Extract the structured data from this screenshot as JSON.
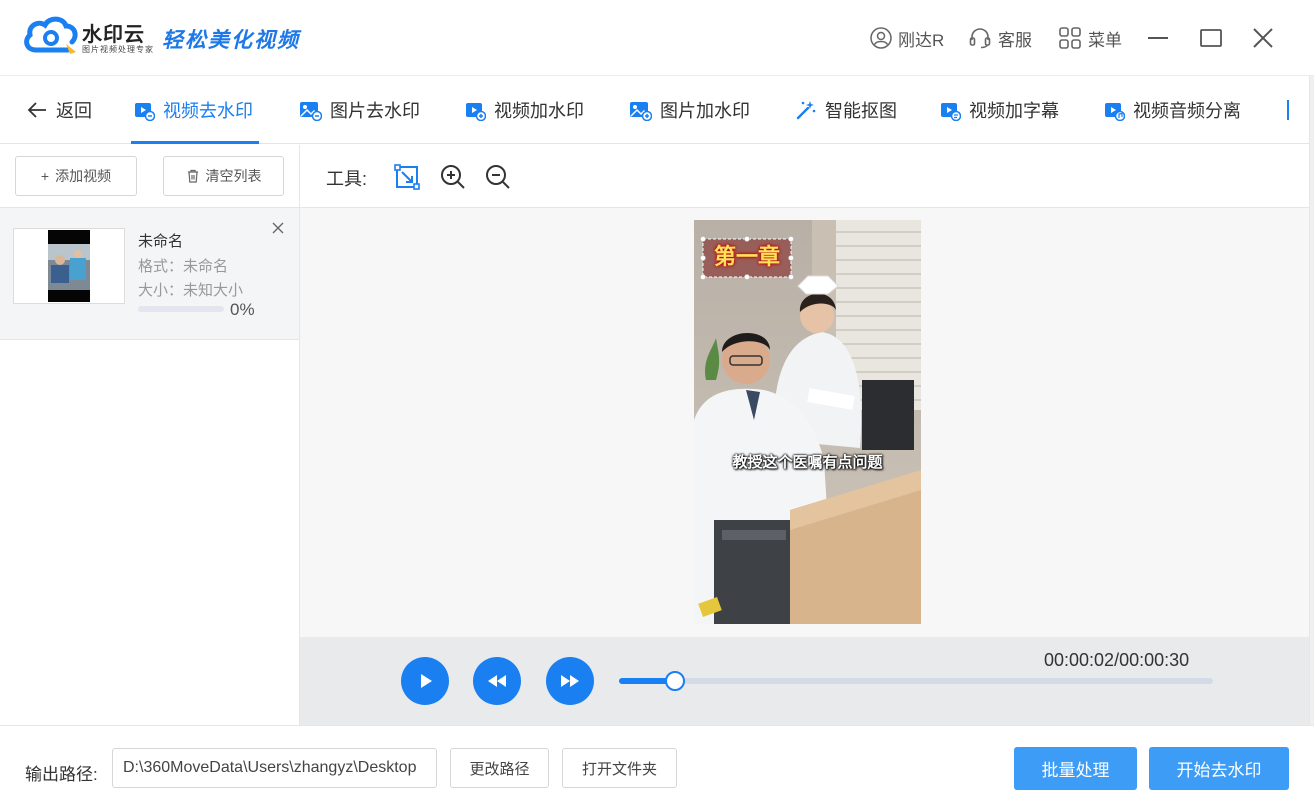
{
  "app": {
    "brand_name": "水印云",
    "brand_subtitle": "图片视频处理专家",
    "slogan": "轻松美化视频",
    "user_label": "刚达R",
    "service_label": "客服",
    "menu_label": "菜单"
  },
  "nav": {
    "back_label": "返回",
    "tabs": [
      {
        "label": "视频去水印"
      },
      {
        "label": "图片去水印"
      },
      {
        "label": "视频加水印"
      },
      {
        "label": "图片加水印"
      },
      {
        "label": "智能抠图"
      },
      {
        "label": "视频加字幕"
      },
      {
        "label": "视频音频分离"
      }
    ]
  },
  "sidebar": {
    "add_video_label": "添加视频",
    "clear_list_label": "清空列表",
    "file": {
      "name": "未命名",
      "format": "格式：未命名",
      "size": "大小：未知大小",
      "progress_text": "0%",
      "progress": 0
    }
  },
  "toolbar": {
    "label": "工具:"
  },
  "video": {
    "title_overlay": "第一章",
    "subtitle": "教授这个医嘱有点问题"
  },
  "player": {
    "timecode": "00:00:02/00:00:30",
    "position_fraction": 0.094
  },
  "footer": {
    "output_label": "输出路径:",
    "output_path": "D:\\360MoveData\\Users\\zhangyz\\Desktop",
    "change_path_label": "更改路径",
    "open_folder_label": "打开文件夹",
    "batch_label": "批量处理",
    "start_label": "开始去水印"
  },
  "colors": {
    "accent": "#1a7ff0",
    "primary_button": "#3d9cf5"
  }
}
